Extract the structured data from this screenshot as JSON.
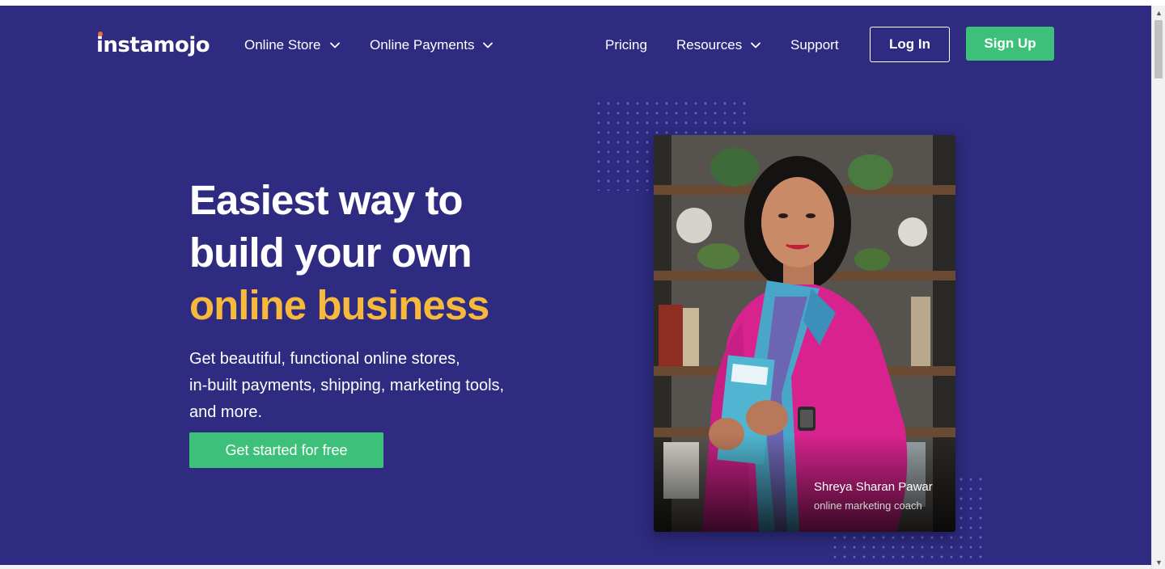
{
  "brand": {
    "logo_text": "instamojo"
  },
  "nav": {
    "online_store": "Online Store",
    "online_payments": "Online Payments",
    "pricing": "Pricing",
    "resources": "Resources",
    "support": "Support",
    "login": "Log In",
    "signup": "Sign Up",
    "dropdown_icon": "chevron-down-icon"
  },
  "hero": {
    "heading_line1": "Easiest way to",
    "heading_line2": "build your own",
    "heading_accent": "online business",
    "sub_line1": "Get beautiful, functional online stores,",
    "sub_line2": "in-built payments, shipping, marketing tools,",
    "sub_line3": "and more.",
    "cta": "Get started for free"
  },
  "testimonial": {
    "name": "Shreya Sharan Pawar",
    "role": "online marketing coach"
  },
  "colors": {
    "hero_bg": "#2e2b80",
    "accent_yellow": "#f6b93b",
    "cta_green": "#3dc17a",
    "logo_dot": "#f26b3a"
  }
}
